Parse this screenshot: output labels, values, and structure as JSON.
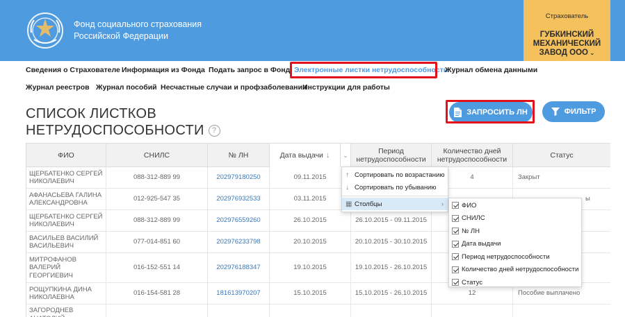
{
  "header": {
    "org_name_line1": "Фонд социального страхования",
    "org_name_line2": "Российской Федерации",
    "logo_icon": "fss-emblem-icon",
    "insurer": {
      "label": "Страхователь",
      "name_line1": "ГУБКИНСКИЙ",
      "name_line2": "МЕХАНИЧЕСКИЙ",
      "name_line3": "ЗАВОД ООО",
      "chevron": "⌄"
    }
  },
  "nav": {
    "row1": [
      {
        "label": "Сведения о Страхователе"
      },
      {
        "label": "Информация из Фонда"
      },
      {
        "label": "Подать запрос в Фонд"
      },
      {
        "label": "Электронные листки нетрудоспособности",
        "active": true
      },
      {
        "label": "Журнал обмена данными"
      }
    ],
    "row2": [
      {
        "label": "Журнал реестров"
      },
      {
        "label": "Журнал пособий"
      },
      {
        "label": "Несчастные случаи и профзаболевания"
      },
      {
        "label": "Инструкции для работы"
      }
    ]
  },
  "page": {
    "title_line1": "СПИСОК ЛИСТКОВ",
    "title_line2": "НЕТРУДОСПОСОБНОСТИ",
    "help": "?",
    "request_button": "ЗАПРОСИТЬ ЛН",
    "filter_button": "ФИЛЬТР"
  },
  "table": {
    "columns": [
      "ФИО",
      "СНИЛС",
      "№ ЛН",
      "Дата выдачи",
      "Период нетрудоспособности",
      "Количество дней нетрудоспособности",
      "Статус"
    ],
    "sort_arrow": "↓",
    "menu_caret": "⌄",
    "rows": [
      {
        "fio": "ЩЕРБАТЕНКО СЕРГЕЙ НИКОЛАЕВИЧ",
        "snils": "088-312-889 99",
        "ln": "202979180250",
        "date": "09.11.2015",
        "period": "",
        "days": "4",
        "status": "Закрыт"
      },
      {
        "fio": "АФАНАСЬЕВА ГАЛИНА АЛЕКСАНДРОВНА",
        "snils": "012-925-547 35",
        "ln": "202976932533",
        "date": "03.11.2015",
        "period": "",
        "days": "",
        "status": "ы"
      },
      {
        "fio": "ЩЕРБАТЕНКО СЕРГЕЙ НИКОЛАЕВИЧ",
        "snils": "088-312-889 99",
        "ln": "202976559260",
        "date": "26.10.2015",
        "period": "26.10.2015 - 09.11.2015",
        "days": "",
        "status": ""
      },
      {
        "fio": "ВАСИЛЬЕВ ВАСИЛИЙ ВАСИЛЬЕВИЧ",
        "snils": "077-014-851 60",
        "ln": "202976233798",
        "date": "20.10.2015",
        "period": "20.10.2015 - 30.10.2015",
        "days": "",
        "status": ""
      },
      {
        "fio": "МИТРОФАНОВ ВАЛЕРИЙ ГЕОРГИЕВИЧ",
        "snils": "016-152-551 14",
        "ln": "202976188347",
        "date": "19.10.2015",
        "period": "19.10.2015 - 26.10.2015",
        "days": "",
        "status": ""
      },
      {
        "fio": "РОЩУПКИНА ДИНА НИКОЛАЕВНА",
        "snils": "016-154-581 28",
        "ln": "181613970207",
        "date": "15.10.2015",
        "period": "15.10.2015 - 26.10.2015",
        "days": "12",
        "status": "Пособие выплачено"
      },
      {
        "fio": "ЗАГОРОДНЕВ АНАТОЛИЙ",
        "snils": "",
        "ln": "",
        "date": "",
        "period": "",
        "days": "",
        "status": ""
      }
    ]
  },
  "column_menu": {
    "sort_asc": "Сортировать по возрастанию",
    "sort_desc": "Сортировать по убыванию",
    "columns_label": "Столбцы",
    "sort_asc_icon": "↑",
    "sort_desc_icon": "↓",
    "columns_icon": "▦",
    "submenu_arrow": "›",
    "column_toggles": [
      {
        "label": "ФИО",
        "checked": true
      },
      {
        "label": "СНИЛС",
        "checked": true
      },
      {
        "label": "№ ЛН",
        "checked": true
      },
      {
        "label": "Дата выдачи",
        "checked": true
      },
      {
        "label": "Период нетрудоспособности",
        "checked": true
      },
      {
        "label": "Количество дней нетрудоспособности",
        "checked": true
      },
      {
        "label": "Статус",
        "checked": true
      }
    ]
  },
  "colors": {
    "brand_blue": "#4f9be0",
    "insurer_yellow": "#f5c15d",
    "highlight_red": "#e3111a",
    "link_blue": "#3a78b8"
  }
}
